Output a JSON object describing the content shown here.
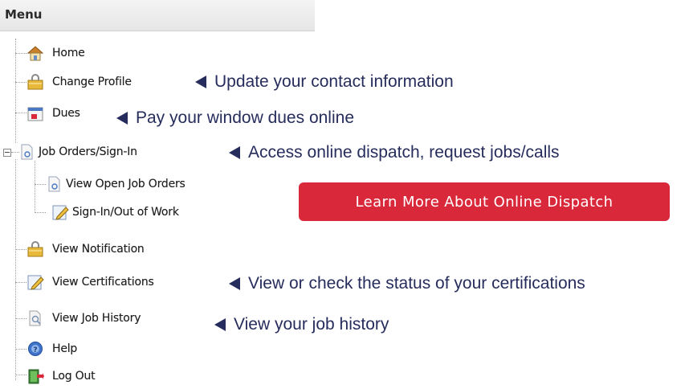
{
  "menu": {
    "title": "Menu",
    "items": [
      {
        "label": "Home",
        "icon": "home-icon"
      },
      {
        "label": "Change Profile",
        "icon": "lock-folder-icon"
      },
      {
        "label": "Dues",
        "icon": "calendar-icon"
      },
      {
        "label": "Job Orders/Sign-In",
        "icon": "document-icon"
      },
      {
        "label": "View Open Job Orders",
        "icon": "document-icon"
      },
      {
        "label": "Sign-In/Out of Work",
        "icon": "pencil-icon"
      },
      {
        "label": "View Notification",
        "icon": "lock-folder-icon"
      },
      {
        "label": "View Certifications",
        "icon": "pencil-icon"
      },
      {
        "label": "View Job History",
        "icon": "magnifier-icon"
      },
      {
        "label": "Help",
        "icon": "help-icon"
      },
      {
        "label": "Log Out",
        "icon": "exit-icon"
      }
    ]
  },
  "annotations": {
    "change_profile": "Update your contact information",
    "dues": "Pay your window dues online",
    "job_orders": "Access online dispatch, request jobs/calls",
    "certifications": "View or check the status of your certifications",
    "job_history": "View your job history"
  },
  "cta": {
    "label": "Learn More About Online Dispatch"
  },
  "colors": {
    "annotation_text": "#262d5c",
    "cta_background": "#d8283a",
    "header_background": "#eeeeee"
  }
}
